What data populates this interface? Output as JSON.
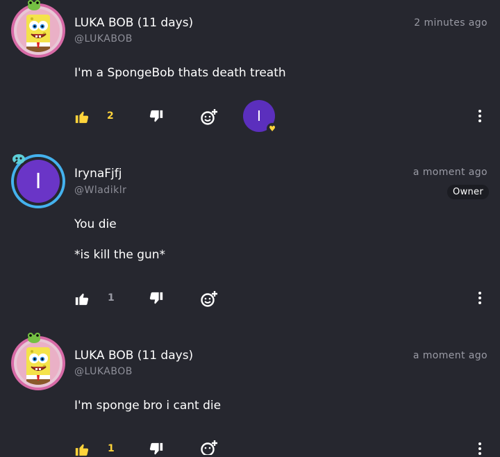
{
  "comments": [
    {
      "username": "LUKA BOB (11 days)",
      "handle": "@LUKABOB",
      "time": "2 minutes ago",
      "text": [
        "I'm a SpongeBob thats death treath"
      ],
      "likes": "2",
      "liked": true,
      "avatar": "spongebob-avatar",
      "reactor_initial": "I"
    },
    {
      "username": "IrynaFjfj",
      "handle": "@Wladiklr",
      "time": "a moment ago",
      "badge": "Owner",
      "text": [
        "You die",
        "*is kill the gun*"
      ],
      "likes": "1",
      "liked": false,
      "avatar_initial": "I"
    },
    {
      "username": "LUKA BOB (11 days)",
      "handle": "@LUKABOB",
      "time": "a moment ago",
      "text": [
        "I'm sponge bro i cant die"
      ],
      "likes": "1",
      "liked": true,
      "avatar": "spongebob-avatar"
    }
  ],
  "colors": {
    "background": "#26272f",
    "like_active": "#ffd43b",
    "muted": "#9a9ba5",
    "pink_ring": "#d76aa6",
    "blue_ring": "#44b2ee",
    "avatar_purple": "#6a35c7"
  }
}
